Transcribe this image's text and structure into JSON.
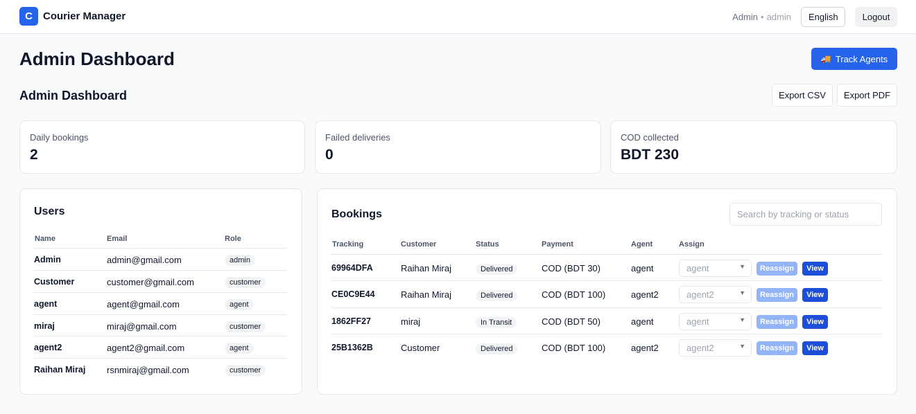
{
  "header": {
    "logo_letter": "C",
    "app_name": "Courier Manager",
    "user_name": "Admin",
    "user_handle": "admin",
    "language": "English",
    "logout_label": "Logout"
  },
  "page": {
    "title": "Admin Dashboard",
    "track_agents_label": "Track Agents",
    "subtitle": "Admin Dashboard",
    "export_csv_label": "Export CSV",
    "export_pdf_label": "Export PDF"
  },
  "stats": [
    {
      "label": "Daily bookings",
      "value": "2"
    },
    {
      "label": "Failed deliveries",
      "value": "0"
    },
    {
      "label": "COD collected",
      "value": "BDT 230"
    }
  ],
  "users": {
    "title": "Users",
    "columns": [
      "Name",
      "Email",
      "Role"
    ],
    "rows": [
      {
        "name": "Admin",
        "email": "admin@gmail.com",
        "role": "admin"
      },
      {
        "name": "Customer",
        "email": "customer@gmail.com",
        "role": "customer"
      },
      {
        "name": "agent",
        "email": "agent@gmail.com",
        "role": "agent"
      },
      {
        "name": "miraj",
        "email": "miraj@gmail.com",
        "role": "customer"
      },
      {
        "name": "agent2",
        "email": "agent2@gmail.com",
        "role": "agent"
      },
      {
        "name": "Raihan Miraj",
        "email": "rsnmiraj@gmail.com",
        "role": "customer"
      }
    ]
  },
  "bookings": {
    "title": "Bookings",
    "search_placeholder": "Search by tracking or status",
    "columns": [
      "Tracking",
      "Customer",
      "Status",
      "Payment",
      "Agent",
      "Assign"
    ],
    "reassign_label": "Reassign",
    "view_label": "View",
    "rows": [
      {
        "tracking": "69964DFA",
        "customer": "Raihan Miraj",
        "status": "Delivered",
        "payment": "COD (BDT 30)",
        "agent": "agent",
        "assign": "agent"
      },
      {
        "tracking": "CE0C9E44",
        "customer": "Raihan Miraj",
        "status": "Delivered",
        "payment": "COD (BDT 100)",
        "agent": "agent2",
        "assign": "agent2"
      },
      {
        "tracking": "1862FF27",
        "customer": "miraj",
        "status": "In Transit",
        "payment": "COD (BDT 50)",
        "agent": "agent",
        "assign": "agent"
      },
      {
        "tracking": "25B1362B",
        "customer": "Customer",
        "status": "Delivered",
        "payment": "COD (BDT 100)",
        "agent": "agent2",
        "assign": "agent2"
      }
    ]
  },
  "colors": {
    "accent": "#2563eb",
    "view_button": "#1d4ed8",
    "reassign_disabled": "#93b4f7"
  }
}
